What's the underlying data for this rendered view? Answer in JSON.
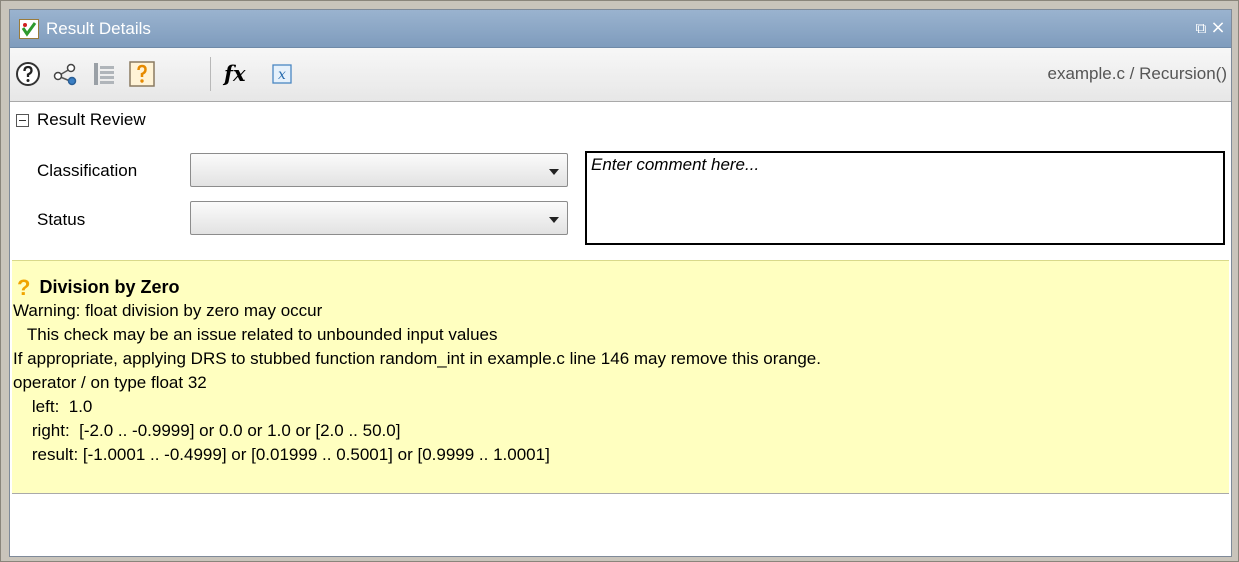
{
  "window": {
    "title": "Result Details",
    "restore_glyph": "⧉",
    "close_glyph": "×"
  },
  "toolbar": {
    "buttons": [
      {
        "icon": "help-icon"
      },
      {
        "icon": "call-graph-icon"
      },
      {
        "icon": "source-code-icon"
      },
      {
        "icon": "orange-check-icon"
      },
      {
        "icon": "function-icon"
      },
      {
        "icon": "variable-icon"
      }
    ],
    "function_glyph": "fx",
    "location": "example.c / Recursion()"
  },
  "review": {
    "header": "Result Review",
    "classification_label": "Classification",
    "classification_value": "",
    "status_label": "Status",
    "status_value": "",
    "comment_placeholder": "Enter comment here..."
  },
  "detail": {
    "status_glyph": "?",
    "title": "Division by Zero",
    "lines": [
      "Warning: float division by zero may occur",
      "   This check may be an issue related to unbounded input values",
      "If appropriate, applying DRS to stubbed function random_int in example.c line 146 may remove this orange.",
      "operator / on type float 32",
      "    left:  1.0",
      "    right:  [-2.0 .. -0.9999] or 0.0 or 1.0 or [2.0 .. 50.0]",
      "    result: [-1.0001 .. -0.4999] or [0.01999 .. 0.5001] or [0.9999 .. 1.0001]"
    ]
  },
  "colors": {
    "titlebar": "#8aa6c6",
    "detail_background": "#ffffc0",
    "orange_accent": "#f0a400"
  }
}
